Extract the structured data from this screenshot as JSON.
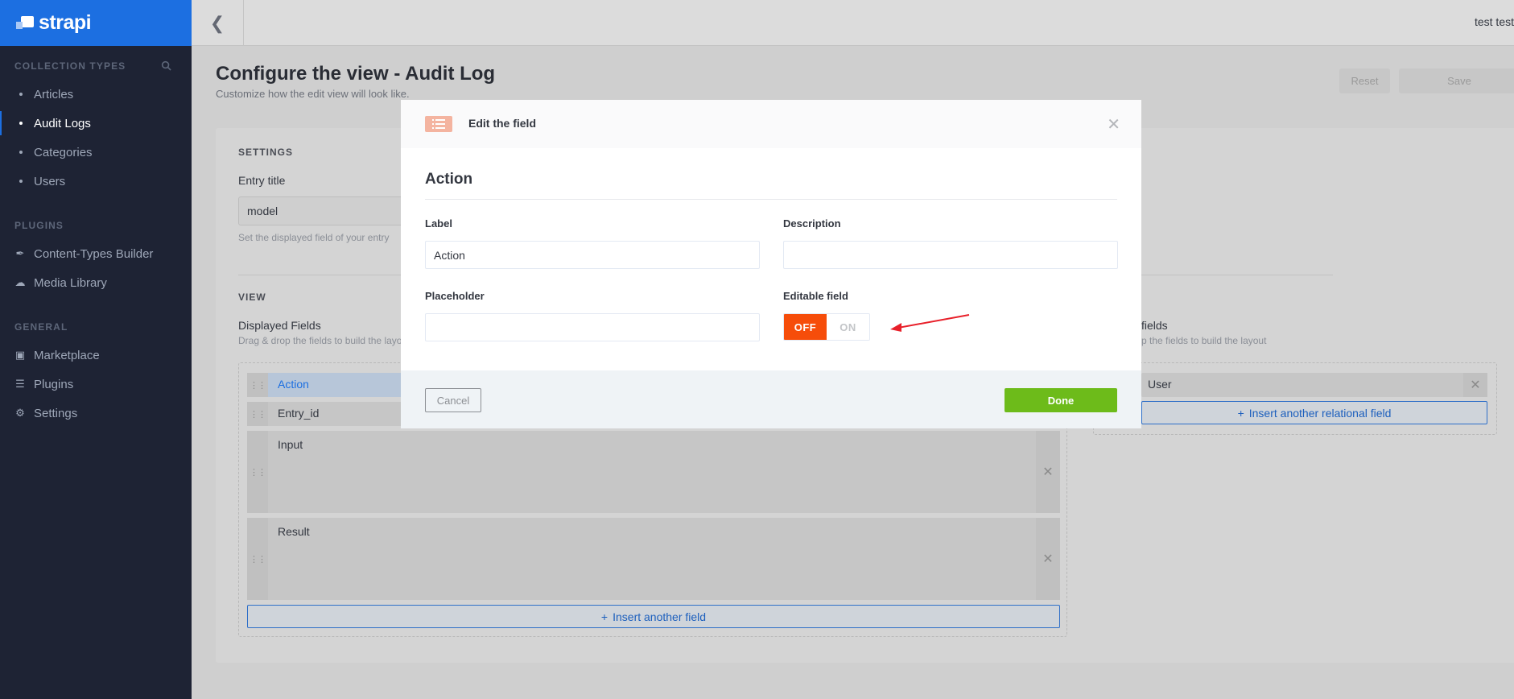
{
  "brand": {
    "name": "strapi"
  },
  "sidebar": {
    "sections": [
      {
        "title": "COLLECTION TYPES"
      },
      {
        "title": "PLUGINS"
      },
      {
        "title": "GENERAL"
      }
    ],
    "collection_types": [
      "Articles",
      "Audit Logs",
      "Categories",
      "Users"
    ],
    "plugins": [
      {
        "label": "Content-Types Builder",
        "icon": "paintbrush-icon"
      },
      {
        "label": "Media Library",
        "icon": "cloud-upload-icon"
      }
    ],
    "general": [
      {
        "label": "Marketplace",
        "icon": "basket-icon"
      },
      {
        "label": "Plugins",
        "icon": "list-icon"
      },
      {
        "label": "Settings",
        "icon": "gear-icon"
      }
    ],
    "active_item": "Audit Logs"
  },
  "topbar": {
    "user": "test test"
  },
  "header": {
    "title": "Configure the view - Audit Log",
    "subtitle": "Customize how the edit view will look like.",
    "reset_label": "Reset",
    "save_label": "Save"
  },
  "settings": {
    "section_label": "SETTINGS",
    "entry_title_label": "Entry title",
    "entry_title_value": "model",
    "entry_title_hint": "Set the displayed field of your entry"
  },
  "view": {
    "section_label": "VIEW",
    "displayed_label": "Displayed Fields",
    "displayed_hint": "Drag & drop the fields to build the layout",
    "fields": [
      "Action",
      "Entry_id",
      "Input",
      "Result"
    ],
    "insert_label": "Insert another field",
    "relational_label": "fields",
    "relational_hint": "p the fields to build the layout",
    "relational_fields": [
      "User"
    ],
    "insert_relational_label": "Insert another relational field"
  },
  "modal": {
    "title": "Edit the field",
    "section_title": "Action",
    "label_label": "Label",
    "label_value": "Action",
    "description_label": "Description",
    "description_value": "",
    "placeholder_label": "Placeholder",
    "placeholder_value": "",
    "editable_label": "Editable field",
    "toggle_off": "OFF",
    "toggle_on": "ON",
    "toggle_state": "OFF",
    "cancel_label": "Cancel",
    "done_label": "Done"
  },
  "colors": {
    "sidebar_bg": "#1e2334",
    "brand_bg": "#1c6fe1",
    "toggle_off": "#f64d0a",
    "done_button": "#6dbb1a",
    "annotation_arrow": "#e8202a"
  }
}
